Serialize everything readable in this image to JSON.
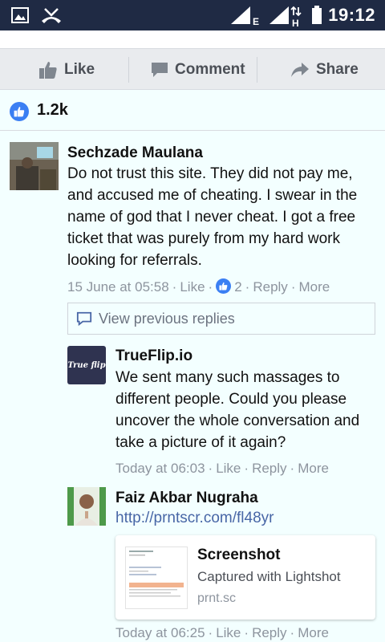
{
  "status_bar": {
    "time": "19:12",
    "icons": [
      "gallery-icon",
      "missed-call-icon",
      "signal-icon",
      "signal-icon",
      "data-arrows-icon",
      "battery-icon"
    ],
    "network_e": "E",
    "network_h": "H"
  },
  "actions": {
    "like": "Like",
    "comment": "Comment",
    "share": "Share"
  },
  "reactions": {
    "count": "1.2k"
  },
  "comments": [
    {
      "author": "Sechzade Maulana",
      "text": "Do not trust this site. They did not pay me, and accused me of cheating. I swear in the name of god that I never cheat. I got a free ticket that was purely from my hard work looking for referrals.",
      "time": "15 June at 05:58",
      "like": "Like",
      "like_count": "2",
      "reply": "Reply",
      "more": "More"
    }
  ],
  "view_previous": "View previous replies",
  "replies": [
    {
      "author": "TrueFlip.io",
      "avatar_text": "True flip",
      "text": "We sent many such massages to different people. Could you please uncover the whole conversation and take a picture of it again?",
      "time": "Today at 06:03",
      "like": "Like",
      "reply": "Reply",
      "more": "More"
    },
    {
      "author": "Faiz Akbar Nugraha",
      "link": "http://prntscr.com/fl48yr",
      "card": {
        "title": "Screenshot",
        "subtitle": "Captured with Lightshot",
        "domain": "prnt.sc"
      },
      "time": "Today at 06:25",
      "like": "Like",
      "reply": "Reply",
      "more": "More"
    }
  ],
  "colors": {
    "status_bar": "#1f2a44",
    "background": "#f3ffff",
    "facebook_blue": "#3b7ff3",
    "link": "#4866a6",
    "meta_gray": "#8d949e"
  }
}
